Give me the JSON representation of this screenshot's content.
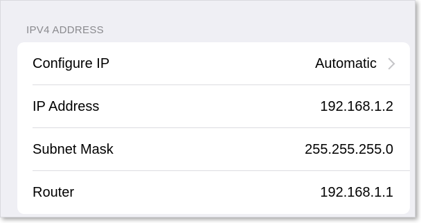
{
  "section": {
    "header": "IPV4 ADDRESS"
  },
  "rows": [
    {
      "label": "Configure IP",
      "value": "Automatic",
      "icon": "chevron-right-icon"
    },
    {
      "label": "IP Address",
      "value": "192.168.1.2"
    },
    {
      "label": "Subnet Mask",
      "value": "255.255.255.0"
    },
    {
      "label": "Router",
      "value": "192.168.1.1"
    }
  ]
}
